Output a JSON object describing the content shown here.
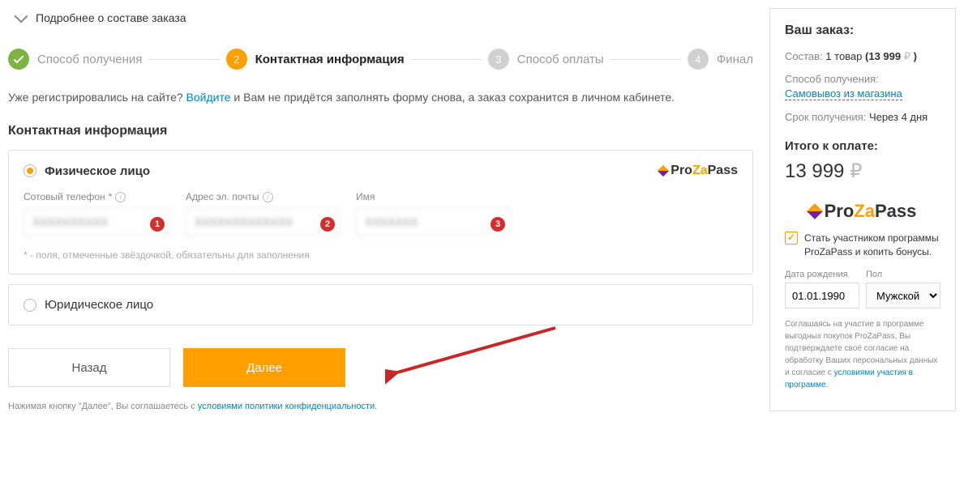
{
  "expand": {
    "label": "Подробнее о составе заказа"
  },
  "steps": [
    {
      "num": "",
      "label": "Способ получения",
      "state": "done"
    },
    {
      "num": "2",
      "label": "Контактная информация",
      "state": "active"
    },
    {
      "num": "3",
      "label": "Способ оплаты",
      "state": "pending"
    },
    {
      "num": "4",
      "label": "Финал",
      "state": "pending"
    }
  ],
  "login_hint": {
    "before": "Уже регистрировались на сайте? ",
    "link": "Войдите",
    "after": " и Вам не придётся заполнять форму снова, а заказ сохранится в личном кабинете."
  },
  "section_title": "Контактная информация",
  "person_types": {
    "individual": "Физическое лицо",
    "legal": "Юридическое лицо"
  },
  "fields": {
    "phone": {
      "label": "Сотовый телефон",
      "req": "*",
      "value": "XXXXXXXXXX",
      "badge": "1"
    },
    "email": {
      "label": "Адрес эл. почты",
      "value": "XXXXXXXXXXXXX",
      "badge": "2"
    },
    "name": {
      "label": "Имя",
      "value": "XXXXXXX",
      "badge": "3"
    }
  },
  "footnote": "* - поля, отмеченные звёздочкой, обязательны для заполнения",
  "buttons": {
    "back": "Назад",
    "next": "Далее"
  },
  "terms": {
    "before": "Нажимая кнопку \"Далее\", Вы соглашаетесь с ",
    "link": "условиями политики конфиденциальности",
    "after": "."
  },
  "sidebar": {
    "title": "Ваш заказ:",
    "composition": {
      "label": "Состав: ",
      "items": "1 товар",
      "price": "(13 999",
      "cur": "₽",
      "close": ")"
    },
    "delivery": {
      "label": "Способ получения:",
      "link": "Самовывоз из магазина"
    },
    "term": {
      "label": "Срок получения: ",
      "value": "Через 4 дня"
    },
    "total_label": "Итого к оплате:",
    "total_value": "13 999",
    "total_cur": "₽",
    "prozapass_check": "Стать участником программы ProZaPass и копить бонусы.",
    "dob": {
      "label": "Дата рождения",
      "value": "01.01.1990"
    },
    "gender": {
      "label": "Пол",
      "value": "Мужской"
    },
    "disclaimer": {
      "before": "Соглашаясь на участие в программе выгодных покупок ProZaPass, Вы подтверждаете своё согласие на обработку Ваших персональных данных и согласие с ",
      "link": "условиями участия в программе",
      "after": "."
    }
  }
}
